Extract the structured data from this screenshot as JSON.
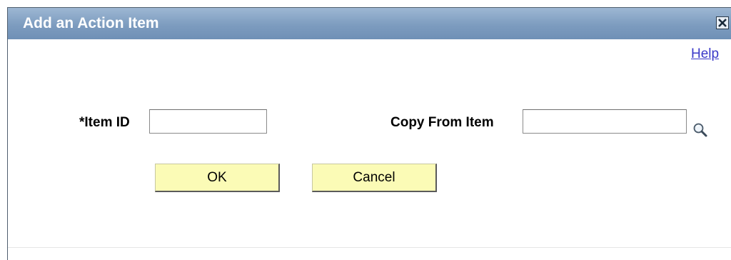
{
  "dialog": {
    "title": "Add an Action Item",
    "close_icon": "close-icon",
    "help_label": "Help"
  },
  "form": {
    "item_id_label": "*Item ID",
    "item_id_value": "",
    "copy_from_label": "Copy From Item",
    "copy_from_value": "",
    "lookup_icon": "magnifier-lookup-icon"
  },
  "buttons": {
    "ok_label": "OK",
    "cancel_label": "Cancel"
  },
  "colors": {
    "titlebar": "#7d9cbf",
    "button_bg": "#fbfbb6",
    "link": "#3a38c8"
  }
}
